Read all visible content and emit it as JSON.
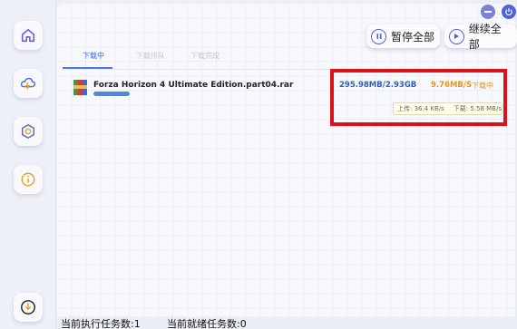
{
  "window": {
    "minimize_icon": "minus-icon",
    "close_icon": "power-icon"
  },
  "sidebar": {
    "items": [
      {
        "name": "home",
        "icon": "home-icon"
      },
      {
        "name": "cloud",
        "icon": "cloud-lightning-icon"
      },
      {
        "name": "settings",
        "icon": "hexagon-gear-icon"
      },
      {
        "name": "about",
        "icon": "info-icon"
      },
      {
        "name": "download",
        "icon": "download-arrow-icon"
      }
    ]
  },
  "toolbar": {
    "pause_all_label": "暂停全部",
    "resume_all_label": "继续全部"
  },
  "tabs": [
    {
      "label": "下载中",
      "active": true
    },
    {
      "label": "下载排队",
      "active": false
    },
    {
      "label": "下载完成",
      "active": false
    }
  ],
  "task": {
    "file_name": "Forza Horizon 4 Ultimate Edition.part04.rar",
    "file_icon": "rar-archive-icon",
    "progress_percent": 10,
    "size": "295.98MB/2.93GB",
    "speed": "9.76MB/S",
    "status": "下载中",
    "upload": "上传: 36.4 KB/s",
    "download": "下载: 5.58 MB/s"
  },
  "footer": {
    "running_tasks": "当前执行任务数:1",
    "ready_tasks": "当前就绪任务数:0"
  },
  "colors": {
    "accent": "#4a78e6",
    "size_text": "#2f5fb3",
    "speed_text": "#e6951f",
    "highlight_border": "#e0101a"
  }
}
